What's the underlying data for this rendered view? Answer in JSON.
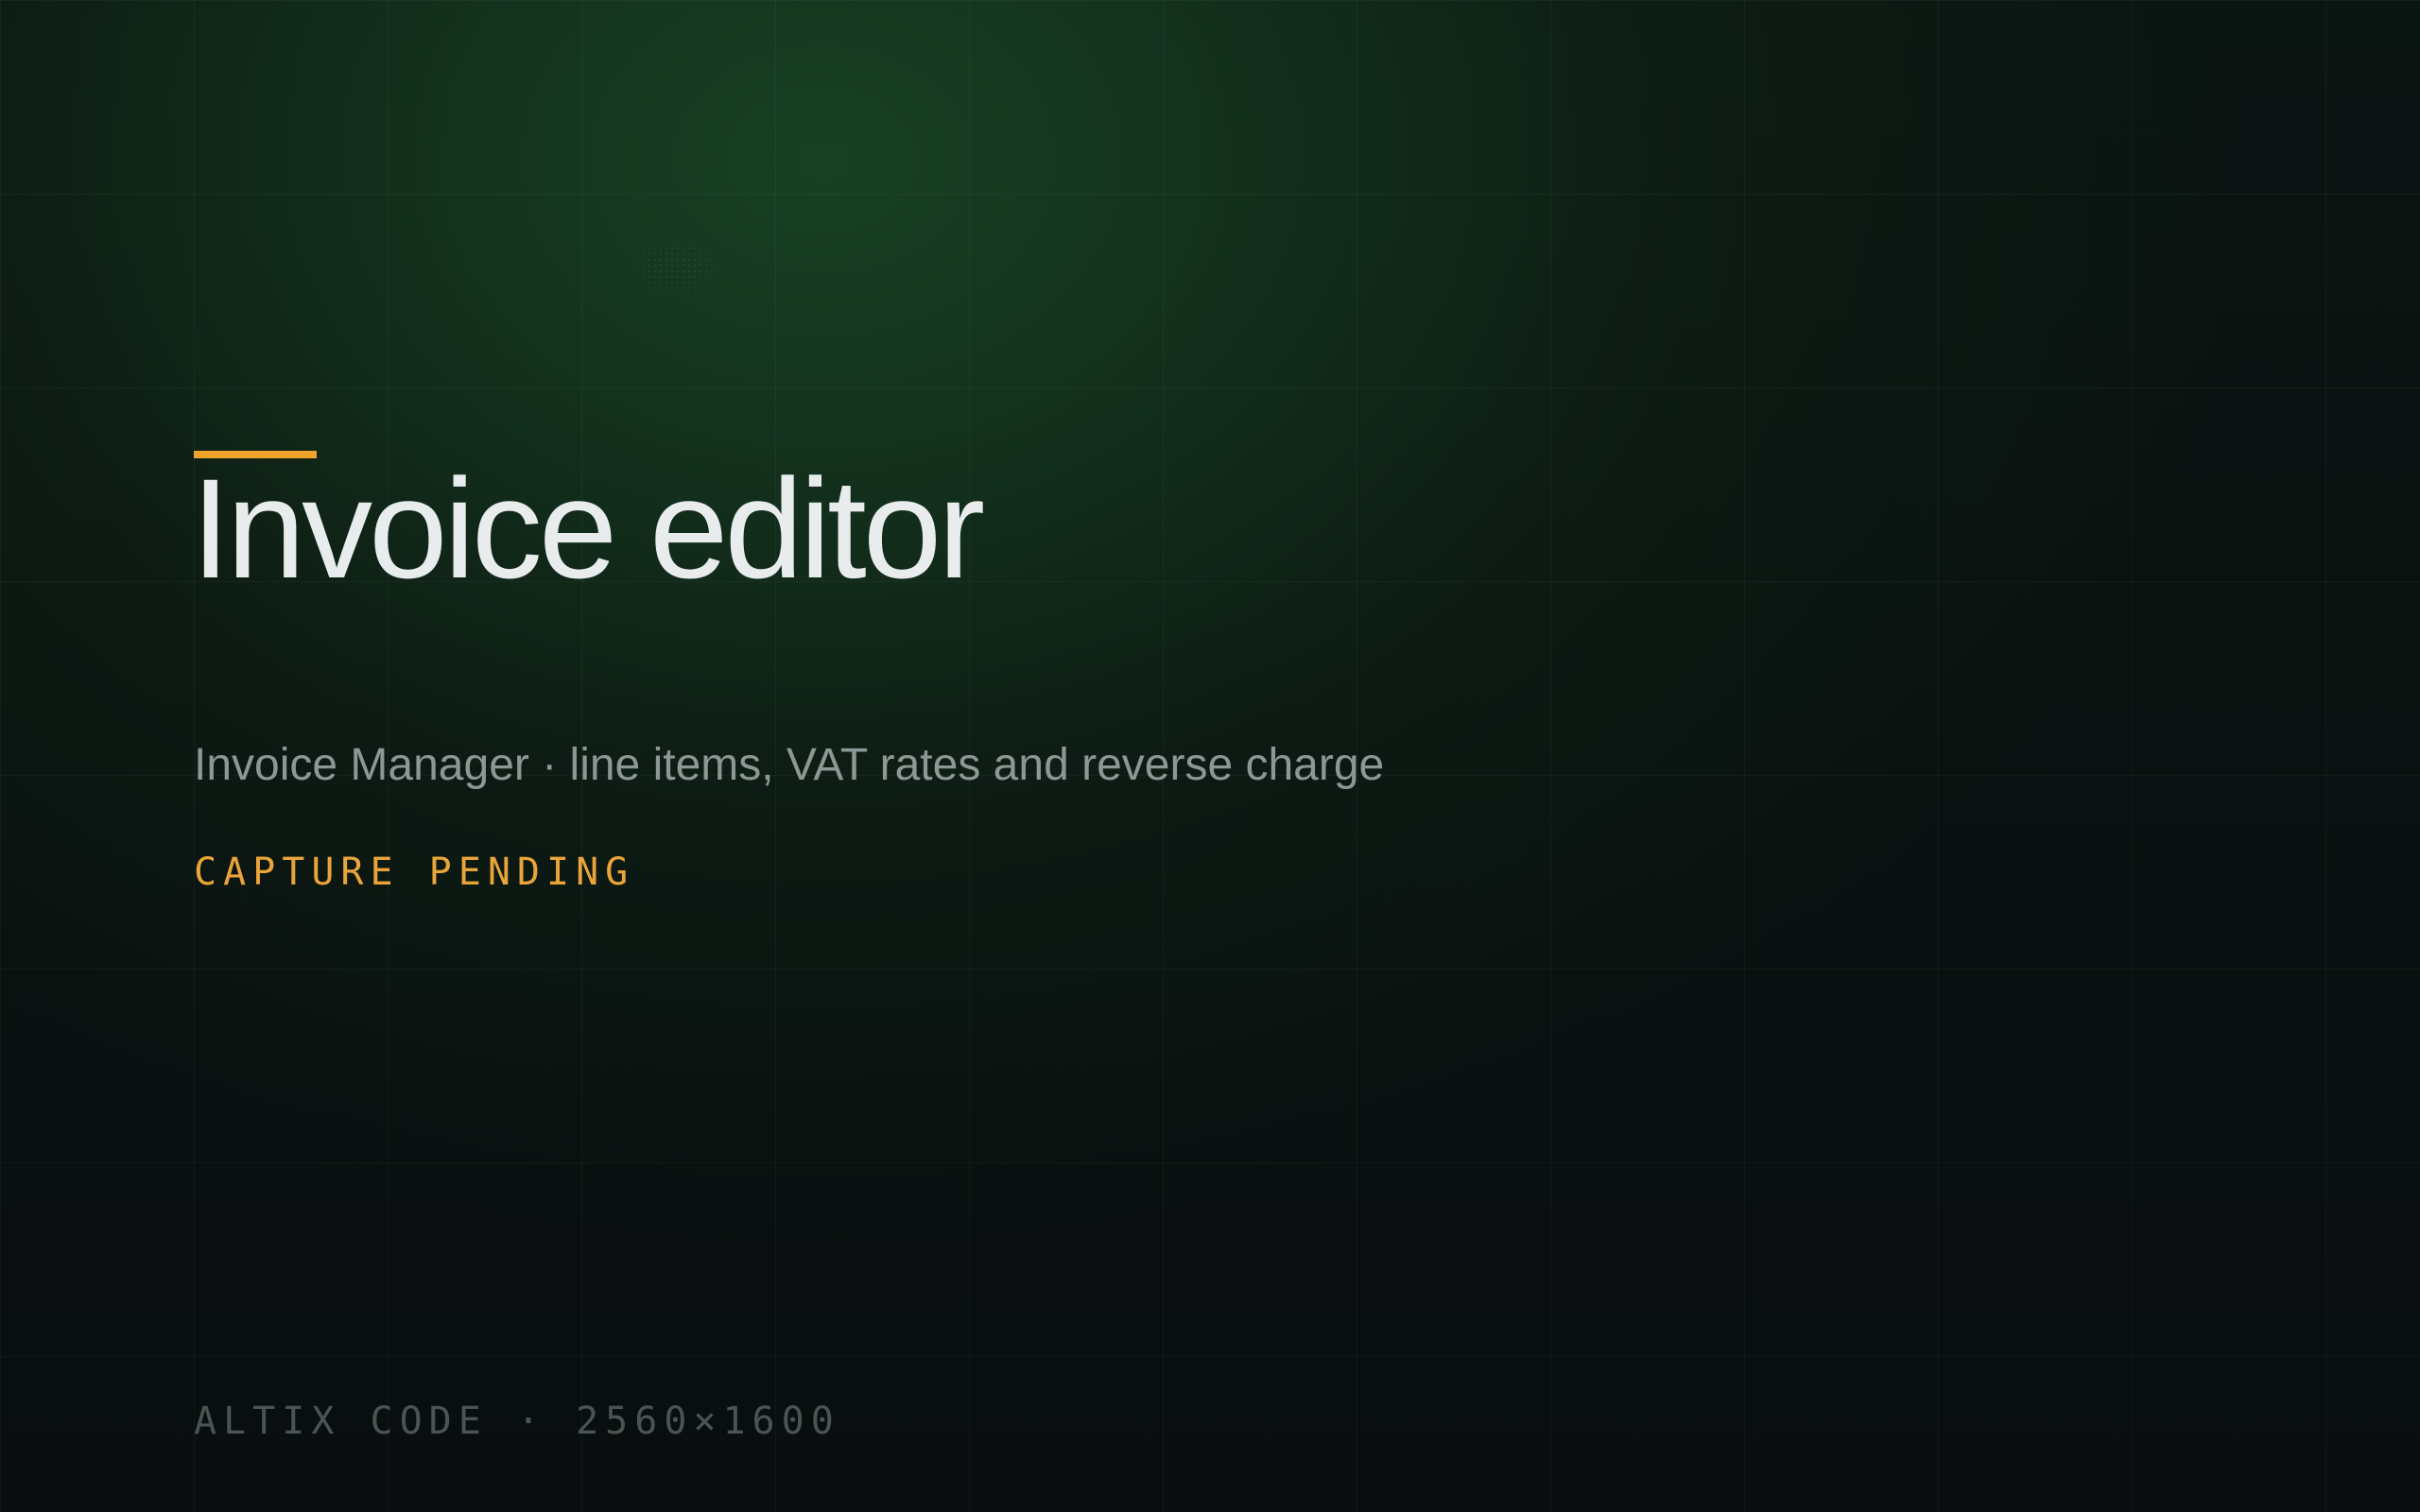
{
  "screen": {
    "title": "Invoice editor",
    "subtitle": "Invoice Manager · line items, VAT rates and reverse charge",
    "status": "CAPTURE PENDING",
    "footer": "ALTIX CODE · 2560×1600"
  },
  "colors": {
    "accent": "#f0a32b",
    "background": "#090d0e",
    "glow": "#184224",
    "title_text": "#e8ecec",
    "subtitle_text": "#8b9895",
    "footer_text": "#4a5553"
  }
}
